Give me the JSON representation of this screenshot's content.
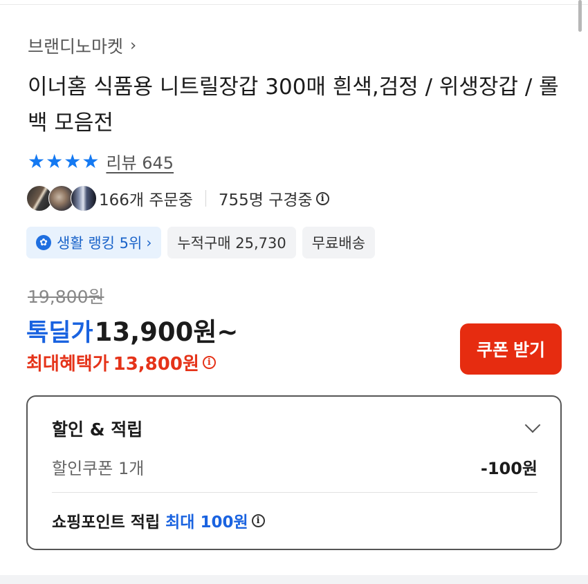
{
  "brand": {
    "name": "브랜디노마켓",
    "chevron": "›"
  },
  "product": {
    "title": "이너홈 식품용 니트릴장갑 300매 흰색,검정 / 위생장갑 / 롤백 모음전"
  },
  "rating": {
    "stars": 4,
    "review_text": "리뷰 645",
    "star_color": "#1479f2"
  },
  "social": {
    "order_count_text": "166개 주문중",
    "viewers_text": "755명 구경중"
  },
  "chips": {
    "rank": "생활 랭킹 5위",
    "cumulative": "누적구매 25,730",
    "shipping": "무료배송"
  },
  "price": {
    "original": "19,800원",
    "deal_label": "톡딜가",
    "deal_price": "13,900원~",
    "max_label": "최대혜택가",
    "max_price": "13,800원",
    "accent_blue": "#1a63e0",
    "accent_red": "#e53319"
  },
  "coupon_button": {
    "label": "쿠폰 받기",
    "color": "#e62c10"
  },
  "benefits": {
    "title": "할인 & 적립",
    "coupon_label": "할인쿠폰 1개",
    "coupon_amount": "-100원",
    "point_label": "쇼핑포인트 적립",
    "point_value": "최대 100원"
  },
  "icons": {
    "info": "i",
    "rank_badge": "✿",
    "star": "★"
  }
}
